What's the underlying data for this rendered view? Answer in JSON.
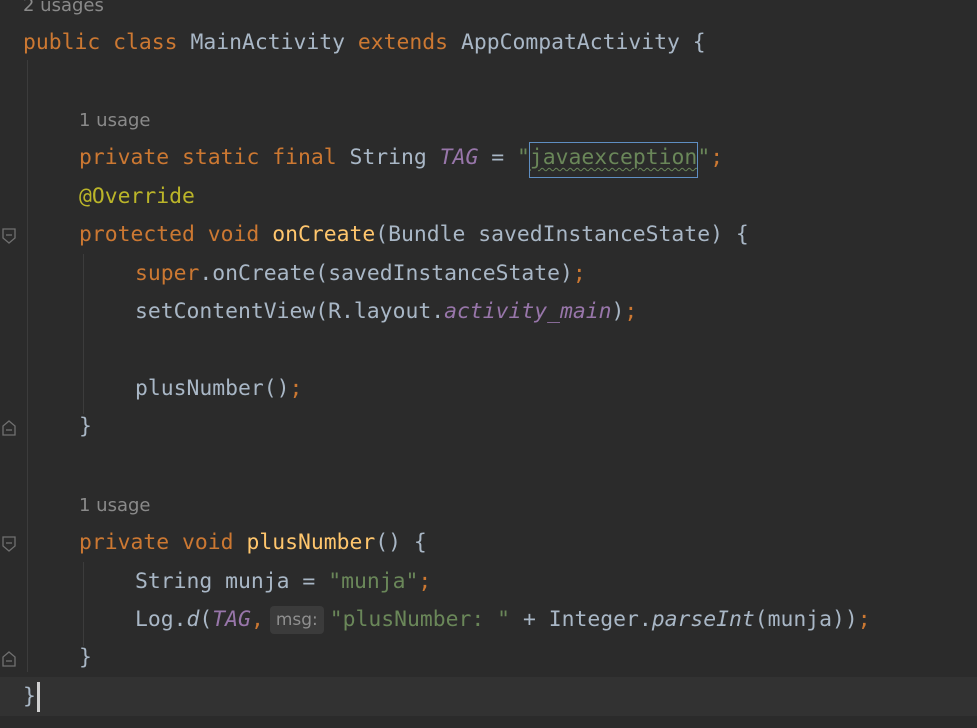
{
  "editor": {
    "usage_hints": {
      "class_usages": "2 usages",
      "tag_usage": "1 usage",
      "plus_number_usage": "1 usage"
    },
    "lines": {
      "class_decl": {
        "kw_public": "public",
        "kw_class": "class",
        "class_name": "MainActivity",
        "kw_extends": "extends",
        "parent": "AppCompatActivity",
        "brace": "{"
      },
      "tag_decl": {
        "kw_private": "private",
        "kw_static": "static",
        "kw_final": "final",
        "type": "String",
        "name": "TAG",
        "eq": "=",
        "quote_open": "\"",
        "value": "javaexception",
        "quote_close": "\"",
        "semi": ";"
      },
      "override": "@Override",
      "oncreate_decl": {
        "kw_protected": "protected",
        "kw_void": "void",
        "method": "onCreate",
        "params": "(Bundle savedInstanceState) {"
      },
      "super_call": {
        "kw_super": "super",
        "rest": ".onCreate(savedInstanceState)",
        "semi": ";"
      },
      "set_content": {
        "call": "setContentView(R.layout.",
        "field": "activity_main",
        "close": ")",
        "semi": ";"
      },
      "plus_call": {
        "call": "plusNumber()",
        "semi": ";"
      },
      "close_brace_1": "}",
      "plus_decl": {
        "kw_private": "private",
        "kw_void": "void",
        "method": "plusNumber",
        "rest": "() {"
      },
      "munja_decl": {
        "lhs": "String munja = ",
        "value": "\"munja\"",
        "semi": ";"
      },
      "log_call": {
        "prefix": "Log.",
        "method": "d",
        "open": "(",
        "tag": "TAG",
        "comma": ",",
        "param_hint": "msg:",
        "str": "\"plusNumber: \"",
        "mid": " + Integer.",
        "parse": "parseInt",
        "tail": "(munja))",
        "semi": ";"
      },
      "close_brace_2": "}",
      "close_brace_class": "}"
    }
  },
  "colors": {
    "background": "#2b2b2b",
    "keyword": "#cc7832",
    "string": "#6a8759",
    "function": "#ffc66d",
    "annotation": "#bbb529",
    "constant": "#9876aa",
    "plain": "#a9b7c6"
  }
}
